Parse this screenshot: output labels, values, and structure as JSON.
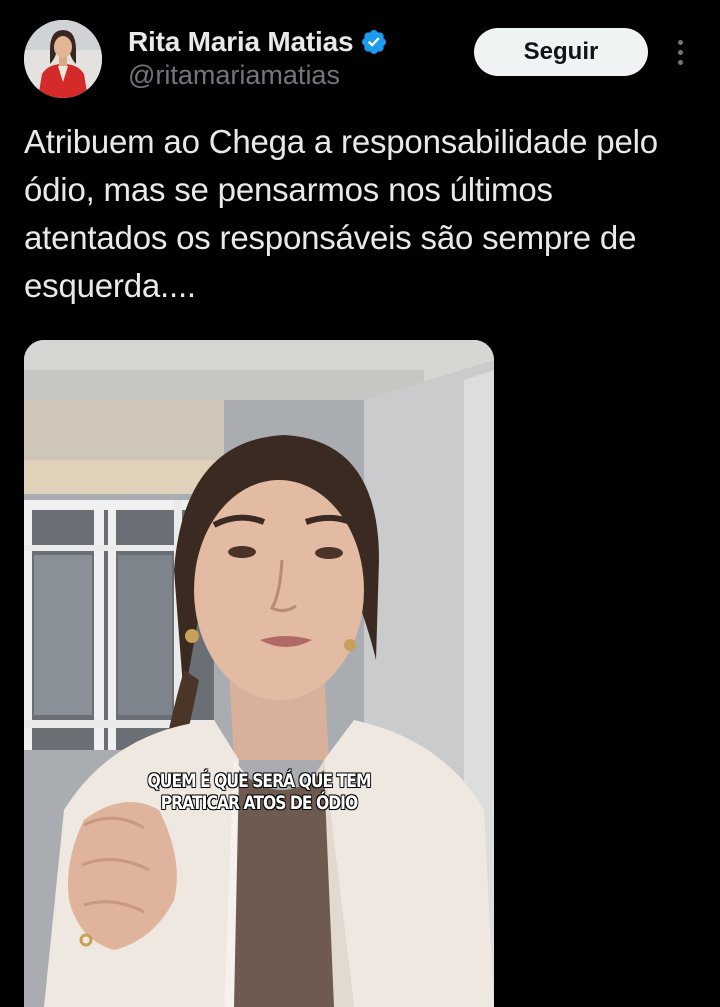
{
  "author": {
    "display_name": "Rita Maria Matias",
    "handle": "@ritamariamatias",
    "verified": true,
    "avatar_icon": "profile-photo-avatar"
  },
  "actions": {
    "follow_label": "Seguir",
    "more_icon": "more-options-icon"
  },
  "tweet": {
    "text": "Atribuem ao Chega a responsabilidade pelo ódio, mas se pensarmos nos últimos atentados os responsáveis são sempre de esquerda...."
  },
  "media": {
    "type": "video-frame",
    "caption_line_1": "QUEM É QUE SERÁ QUE TEM",
    "caption_line_2": "PRATICAR ATOS DE ÓDIO"
  },
  "colors": {
    "background": "#000000",
    "text_primary": "#e7e9ea",
    "text_secondary": "#71767b",
    "verified_badge": "#1d9bf0",
    "follow_button_bg": "#eff3f4",
    "follow_button_text": "#0f1419"
  }
}
